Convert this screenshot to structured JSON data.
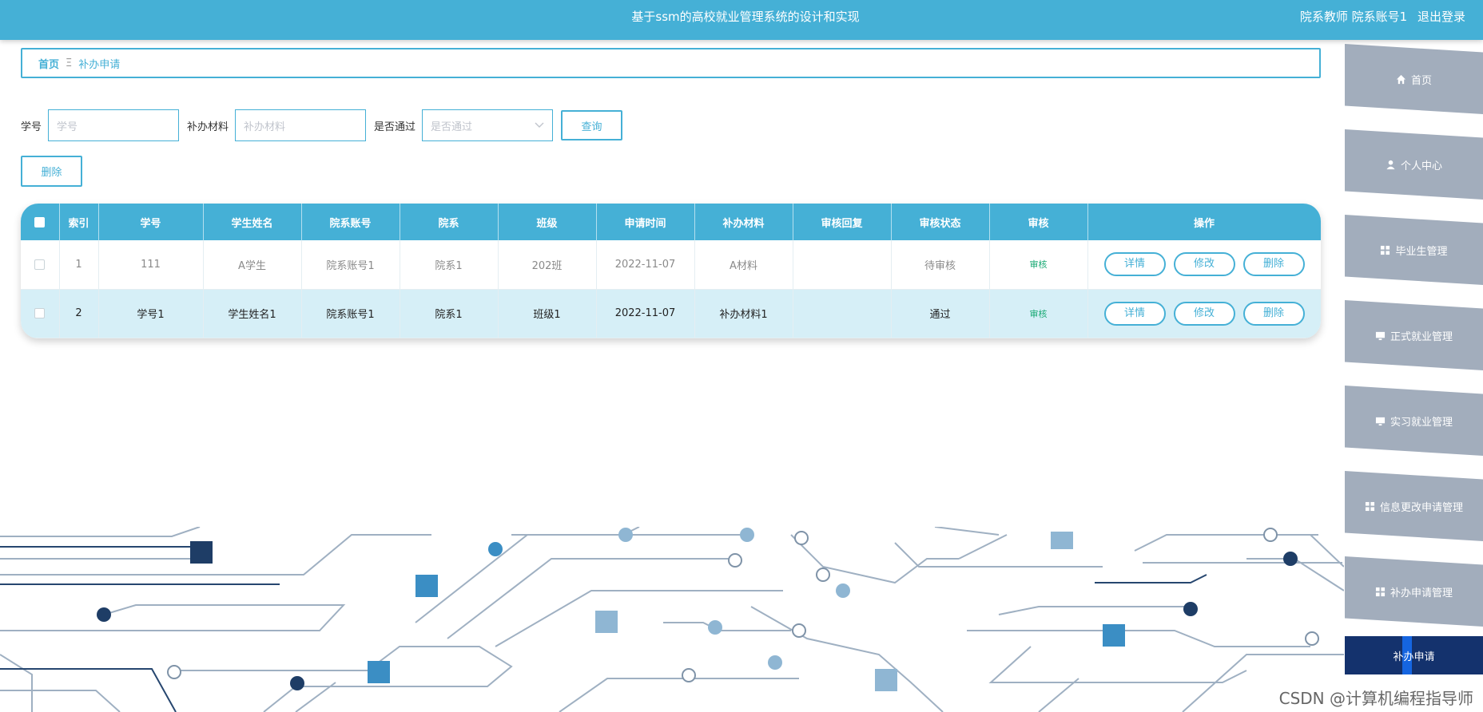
{
  "header": {
    "title": "基于ssm的高校就业管理系统的设计和实现",
    "user": "院系教师 院系账号1",
    "logout": "退出登录"
  },
  "breadcrumb": {
    "home": "首页",
    "separator": "Ξ",
    "current": "补办申请"
  },
  "filters": {
    "student_no": {
      "label": "学号",
      "placeholder": "学号"
    },
    "material": {
      "label": "补办材料",
      "placeholder": "补办材料"
    },
    "passed": {
      "label": "是否通过",
      "placeholder": "是否通过"
    },
    "query_label": "查询"
  },
  "delete_label": "删除",
  "table": {
    "columns": [
      "索引",
      "学号",
      "学生姓名",
      "院系账号",
      "院系",
      "班级",
      "申请时间",
      "补办材料",
      "审核回复",
      "审核状态",
      "审核",
      "操作"
    ],
    "rows": [
      {
        "index": "1",
        "student_no": "111",
        "student_name": "A学生",
        "dept_account": "院系账号1",
        "dept": "院系1",
        "class": "202班",
        "apply_time": "2022-11-07",
        "material": "A材料",
        "reply": "",
        "status": "待审核",
        "audit": "审核"
      },
      {
        "index": "2",
        "student_no": "学号1",
        "student_name": "学生姓名1",
        "dept_account": "院系账号1",
        "dept": "院系1",
        "class": "班级1",
        "apply_time": "2022-11-07",
        "material": "补办材料1",
        "reply": "",
        "status": "通过",
        "audit": "审核"
      }
    ],
    "actions": {
      "detail": "详情",
      "edit": "修改",
      "delete": "删除"
    }
  },
  "sidebar": {
    "items": [
      {
        "label": "首页",
        "icon": "home-icon"
      },
      {
        "label": "个人中心",
        "icon": "user-icon"
      },
      {
        "label": "毕业生管理",
        "icon": "grid-icon"
      },
      {
        "label": "正式就业管理",
        "icon": "monitor-icon"
      },
      {
        "label": "实习就业管理",
        "icon": "monitor-icon"
      },
      {
        "label": "信息更改申请管理",
        "icon": "grid-icon"
      },
      {
        "label": "补办申请管理",
        "icon": "grid-icon"
      }
    ],
    "active": "补办申请"
  },
  "watermark": "CSDN @计算机编程指导师",
  "colors": {
    "primary": "#45b0d6",
    "sidebar": "#a2adbc",
    "active": "#14326d",
    "row_alt": "#d6eff7"
  }
}
